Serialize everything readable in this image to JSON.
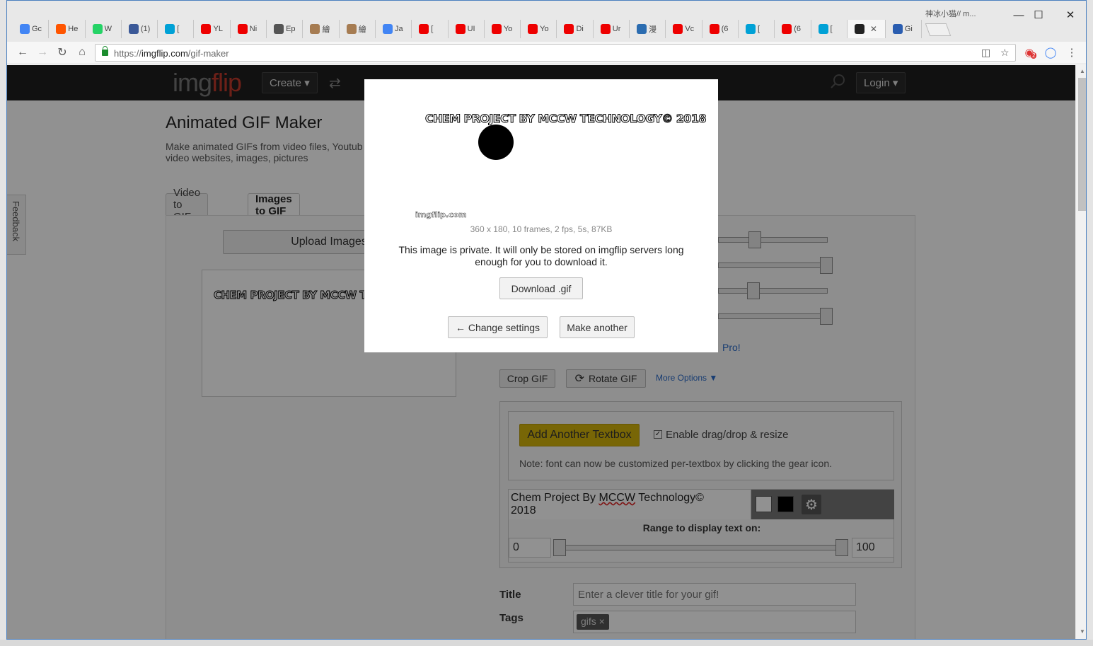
{
  "window": {
    "title": "神冰小猫// m...",
    "tabs": [
      {
        "label": "Gc",
        "icon": "google-docs-icon",
        "color": "#4285f4"
      },
      {
        "label": "He",
        "icon": "soundcloud-icon",
        "color": "#ff5500"
      },
      {
        "label": "W",
        "icon": "whatsapp-icon",
        "color": "#25d366"
      },
      {
        "label": "(1)",
        "icon": "facebook-icon",
        "color": "#3b5998"
      },
      {
        "label": "[",
        "icon": "bilibili-icon",
        "color": "#00a1d6"
      },
      {
        "label": "YL",
        "icon": "youtube-icon",
        "color": "#e00"
      },
      {
        "label": "Ni",
        "icon": "youtube-icon",
        "color": "#e00"
      },
      {
        "label": "Ep",
        "icon": "clock-icon",
        "color": "#555"
      },
      {
        "label": "繪",
        "icon": "cartoon-icon",
        "color": "#a67c52"
      },
      {
        "label": "繪",
        "icon": "cartoon-icon",
        "color": "#a67c52"
      },
      {
        "label": "Ja",
        "icon": "google-icon",
        "color": "#4285f4"
      },
      {
        "label": "[",
        "icon": "youtube-icon",
        "color": "#e00"
      },
      {
        "label": "UI",
        "icon": "youtube-icon",
        "color": "#e00"
      },
      {
        "label": "Yo",
        "icon": "youtube-icon",
        "color": "#e00"
      },
      {
        "label": "Yo",
        "icon": "youtube-icon",
        "color": "#e00"
      },
      {
        "label": "Di",
        "icon": "youtube-icon",
        "color": "#e00"
      },
      {
        "label": "Ur",
        "icon": "youtube-icon",
        "color": "#e00"
      },
      {
        "label": "漫",
        "icon": "bird-icon",
        "color": "#2b6cb0"
      },
      {
        "label": "Vc",
        "icon": "youtube-icon",
        "color": "#e00"
      },
      {
        "label": "(6",
        "icon": "youtube-icon",
        "color": "#e00"
      },
      {
        "label": "[",
        "icon": "bilibili-icon",
        "color": "#00a1d6"
      },
      {
        "label": "(6",
        "icon": "youtube-icon",
        "color": "#e00"
      },
      {
        "label": "[",
        "icon": "bilibili-icon",
        "color": "#00a1d6"
      },
      {
        "label": "",
        "icon": "imgflip-icon",
        "color": "#222",
        "active": true
      },
      {
        "label": "Gi",
        "icon": "m-icon",
        "color": "#2a5db0"
      }
    ]
  },
  "toolbar": {
    "url_scheme": "https://",
    "url_host": "imgflip.com",
    "url_path": "/gif-maker",
    "ext_badge": "2"
  },
  "site": {
    "logo_gray": "img",
    "logo_red": "flip",
    "create_label": "Create ▾",
    "login_label": "Login ▾",
    "feedback_label": "Feedback"
  },
  "main": {
    "title": "Animated GIF Maker",
    "subtitle": "Make animated GIFs from video files, Youtub video websites, images, pictures",
    "tab_video": "Video to GIF",
    "tab_images": "Images to GIF",
    "upload_label": "Upload Images",
    "preview_text": "CHEM PROJECT BY MCCW TECH",
    "pro_text": "Pro!",
    "crop_label": "Crop GIF",
    "rotate_label": "Rotate GIF",
    "more_options": "More Options ▼",
    "add_textbox": "Add Another Textbox",
    "drag_resize": "Enable drag/drop & resize",
    "note": "Note: font can now be customized per-textbox by clicking the gear icon.",
    "textbox_value_1": "Chem Project By ",
    "textbox_value_sp": "MCCW",
    "textbox_value_2": " Technology©",
    "textbox_value_3": "2018",
    "range_label": "Range to display text on:",
    "range_min": "0",
    "range_max": "100",
    "title_label": "Title",
    "title_placeholder": "Enter a clever title for your gif!",
    "tags_label": "Tags",
    "tag_chip": "gifs ×"
  },
  "modal": {
    "gif_title": "CHEM PROJECT BY MCCW TECHNOLOGY© 2018",
    "watermark": "imgflip.com",
    "meta": "360 x 180, 10 frames, 2 fps, 5s, 87KB",
    "private_note": "This image is private. It will only be stored on imgflip servers long enough for you to download it.",
    "download_label": "Download .gif",
    "change_settings_label": "← Change settings",
    "make_another_label": "Make another"
  },
  "colors": {
    "accent_yellow": "#d4b40b",
    "link_blue": "#2a6ac8",
    "header_bg": "#1f1f1f"
  }
}
